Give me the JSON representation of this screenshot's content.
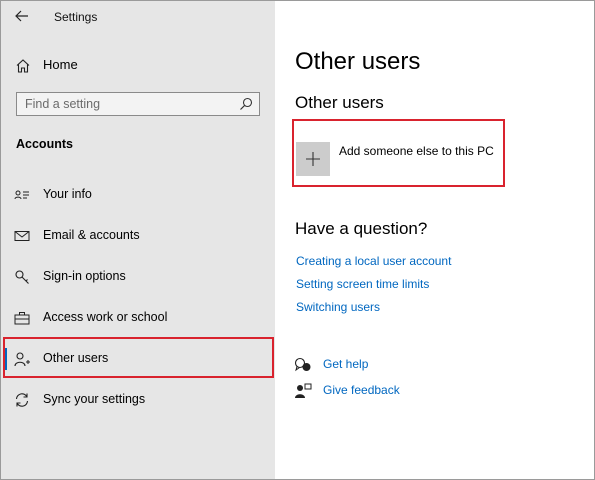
{
  "window": {
    "app_title": "Settings"
  },
  "sidebar": {
    "home_label": "Home",
    "search": {
      "placeholder": "Find a setting"
    },
    "section_label": "Accounts",
    "items": [
      {
        "label": "Your info",
        "icon": "person-card-icon"
      },
      {
        "label": "Email & accounts",
        "icon": "mail-icon"
      },
      {
        "label": "Sign-in options",
        "icon": "key-icon"
      },
      {
        "label": "Access work or school",
        "icon": "briefcase-icon"
      },
      {
        "label": "Other users",
        "icon": "person-add-icon",
        "selected": true
      },
      {
        "label": "Sync your settings",
        "icon": "sync-icon"
      }
    ]
  },
  "main": {
    "title": "Other users",
    "section_title": "Other users",
    "add_user_label": "Add someone else to this PC",
    "question_title": "Have a question?",
    "links": [
      "Creating a local user account",
      "Setting screen time limits",
      "Switching users"
    ],
    "help": {
      "get_help": "Get help",
      "give_feedback": "Give feedback"
    }
  },
  "colors": {
    "accent": "#0067c0",
    "highlight_box": "#d9232e",
    "sidebar_bg": "#e6e6e6"
  }
}
